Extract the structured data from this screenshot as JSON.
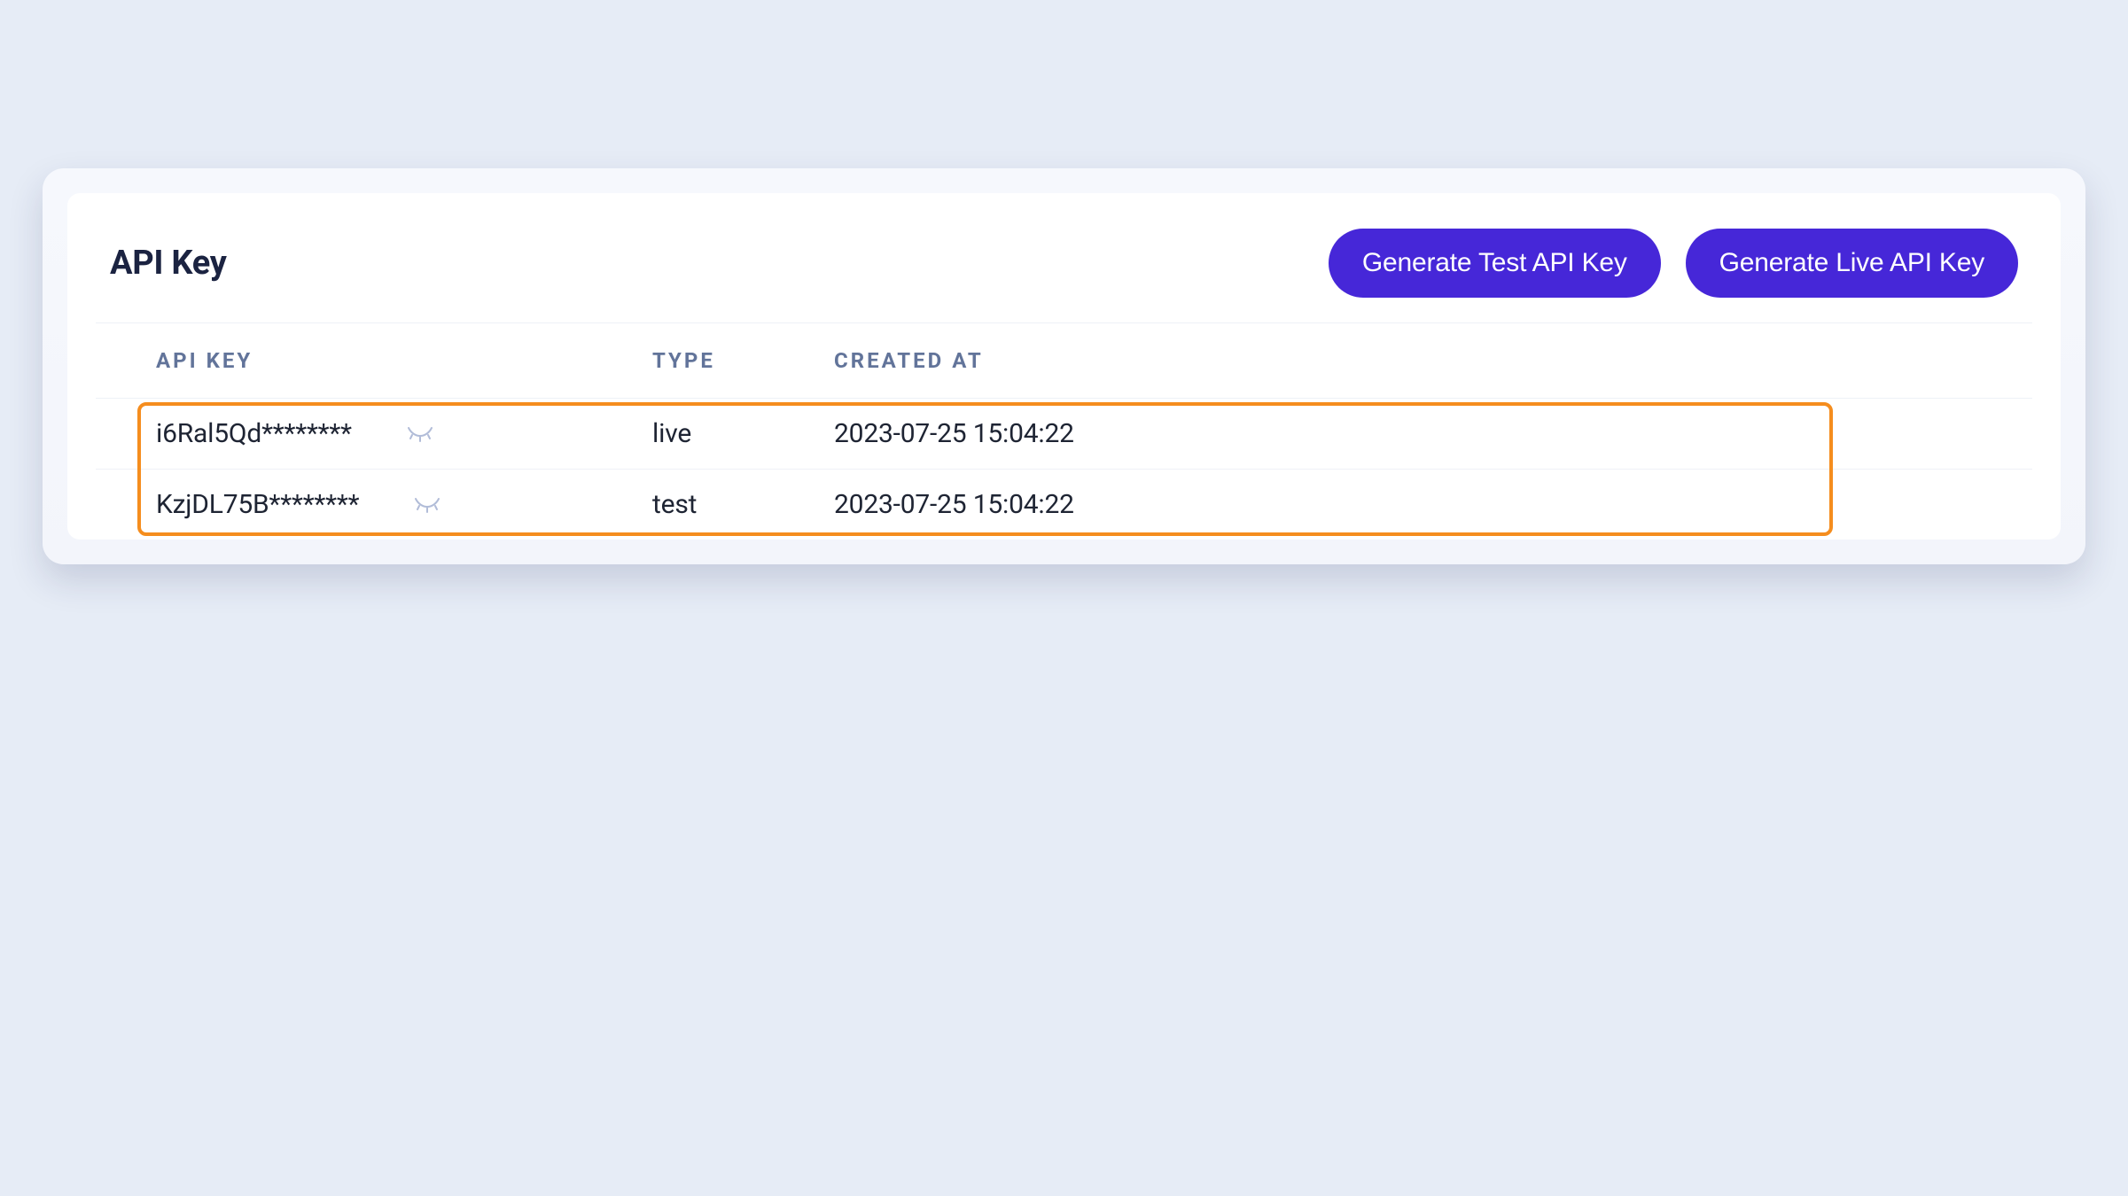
{
  "panel": {
    "title": "API Key",
    "buttons": {
      "generate_test": "Generate Test API Key",
      "generate_live": "Generate Live API Key"
    }
  },
  "table": {
    "headers": {
      "key": "API KEY",
      "type": "TYPE",
      "created": "CREATED AT"
    },
    "rows": [
      {
        "key": "i6Ral5Qd********",
        "type": "live",
        "created": "2023-07-25 15:04:22"
      },
      {
        "key": "KzjDL75B********",
        "type": "test",
        "created": "2023-07-25 15:04:22"
      }
    ]
  }
}
